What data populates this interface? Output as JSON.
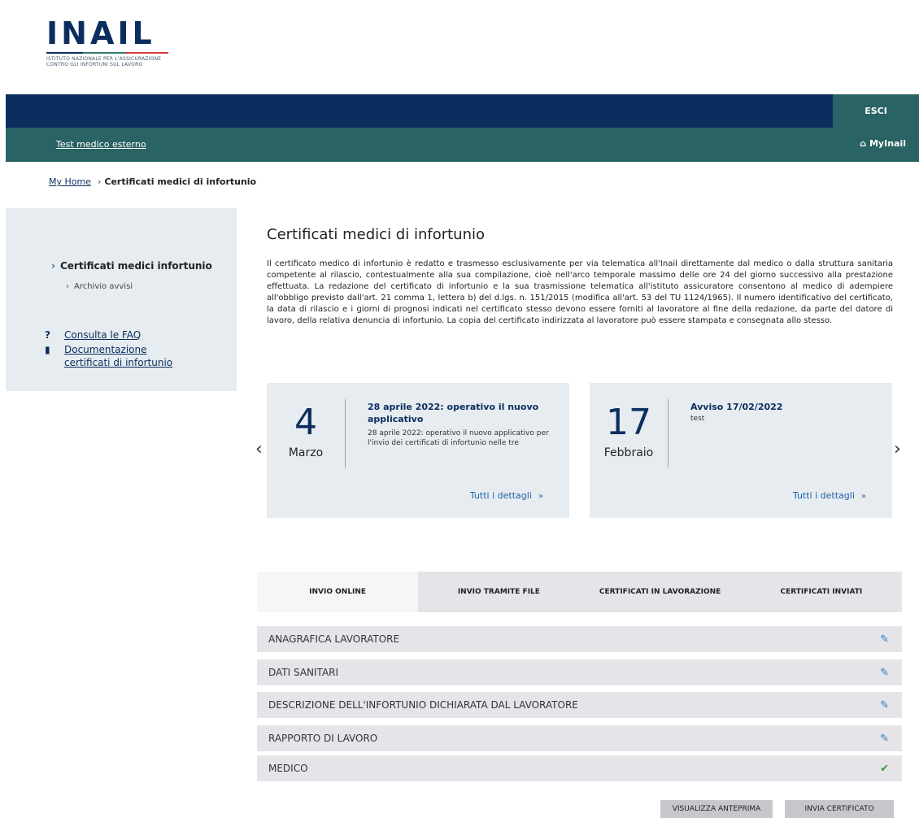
{
  "logo": {
    "text": "INAIL",
    "subtitle_line1": "ISTITUTO NAZIONALE PER L'ASSICURAZIONE",
    "subtitle_line2": "CONTRO GLI INFORTUNI SUL LAVORO"
  },
  "header": {
    "logout_label": "ESCI",
    "user_name": "Test medico esterno",
    "myinail_label": "MyInail",
    "myinail_icon": "home-icon"
  },
  "breadcrumb": {
    "home_label": "My Home",
    "current_label": "Certificati medici di infortunio"
  },
  "sidebar": {
    "main_item": "Certificati medici infortunio",
    "sub_item": "Archivio avvisi",
    "faq_label": "Consulta le FAQ",
    "doc_label": "Documentazione certificati di infortunio"
  },
  "main": {
    "title": "Certificati medici di infortunio",
    "intro": "Il certificato medico di infortunio è redatto e trasmesso esclusivamente per via telematica all'Inail direttamente dal medico o dalla struttura sanitaria competente al rilascio, contestualmente alla sua compilazione, cioè nell'arco temporale massimo delle ore 24 del giorno successivo alla prestazione effettuata. La redazione del certificato di infortunio e la sua trasmissione telematica all'istituto assicuratore consentono al medico di adempiere all'obbligo previsto dall'art. 21 comma 1, lettera b) del d.lgs. n. 151/2015 (modifica all'art. 53 del TU 1124/1965). Il numero identificativo del certificato, la data di rilascio e i giorni di prognosi indicati nel certificato stesso devono essere forniti al lavoratore al fine della redazione, da parte del datore di lavoro, della relativa denuncia di infortunio. La copia del certificato indirizzata al lavoratore può essere stampata e consegnata allo stesso."
  },
  "news": [
    {
      "day": "4",
      "month": "Marzo",
      "title": "28 aprile 2022: operativo il nuovo applicativo",
      "body": "28 aprile 2022: operativo il nuovo applicativo per l'invio dei certificati di infortunio nelle tre",
      "details_label": "Tutti i dettagli"
    },
    {
      "day": "17",
      "month": "Febbraio",
      "title": "Avviso 17/02/2022",
      "body": "test",
      "details_label": "Tutti i dettagli"
    }
  ],
  "tabs": [
    {
      "label": "INVIO ONLINE",
      "active": true
    },
    {
      "label": "INVIO TRAMITE FILE",
      "active": false
    },
    {
      "label": "CERTIFICATI IN LAVORAZIONE",
      "active": false
    },
    {
      "label": "CERTIFICATI INVIATI",
      "active": false
    }
  ],
  "sections": [
    {
      "label": "ANAGRAFICA LAVORATORE",
      "icon": "edit-icon"
    },
    {
      "label": "DATI SANITARI",
      "icon": "edit-icon"
    },
    {
      "label": "DESCRIZIONE DELL'INFORTUNIO DICHIARATA DAL LAVORATORE",
      "icon": "edit-icon"
    },
    {
      "label": "RAPPORTO DI LAVORO",
      "icon": "edit-icon"
    },
    {
      "label": "MEDICO",
      "icon": "check-icon"
    }
  ],
  "actions": {
    "preview_label": "VISUALIZZA ANTEPRIMA",
    "send_label": "INVIA CERTIFICATO"
  },
  "colors": {
    "navy": "#0b2e5e",
    "teal": "#2a6363",
    "panel": "#e6ecf0",
    "link_blue": "#1f5fa8",
    "check_green": "#3a9a2e"
  }
}
